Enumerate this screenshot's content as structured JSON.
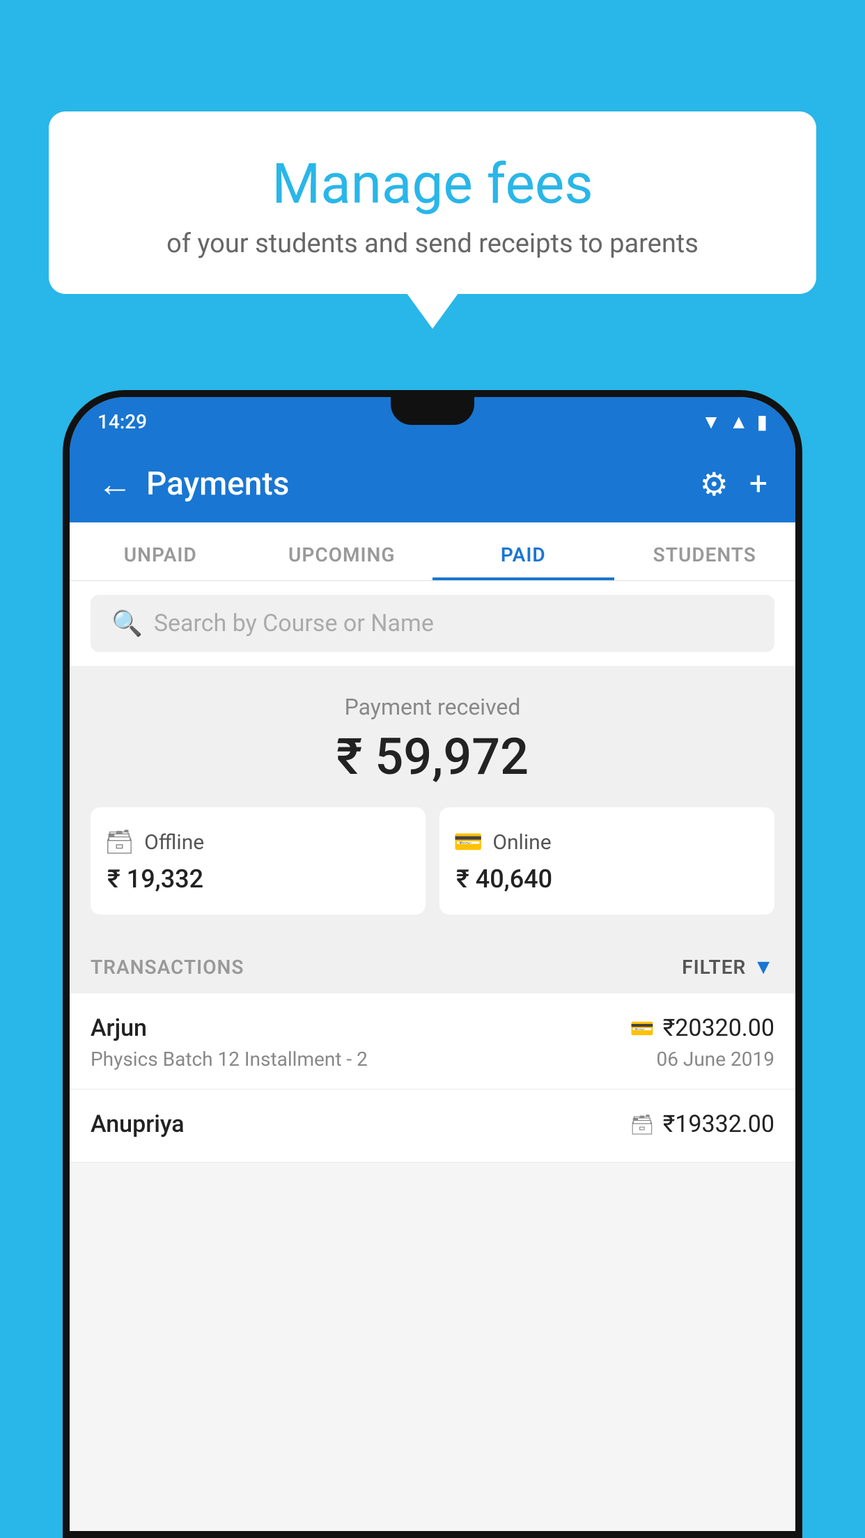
{
  "background_color": "#29b6e8",
  "bubble": {
    "title": "Manage fees",
    "subtitle": "of your students and send receipts to parents"
  },
  "status_bar": {
    "time": "14:29",
    "wifi": "▼",
    "signal": "▲",
    "battery": "▮"
  },
  "app_bar": {
    "title": "Payments",
    "back_label": "←",
    "gear_label": "⚙",
    "plus_label": "+"
  },
  "tabs": [
    {
      "id": "unpaid",
      "label": "UNPAID",
      "active": false
    },
    {
      "id": "upcoming",
      "label": "UPCOMING",
      "active": false
    },
    {
      "id": "paid",
      "label": "PAID",
      "active": true
    },
    {
      "id": "students",
      "label": "STUDENTS",
      "active": false
    }
  ],
  "search": {
    "placeholder": "Search by Course or Name"
  },
  "payment": {
    "received_label": "Payment received",
    "total_amount": "₹ 59,972",
    "offline_label": "Offline",
    "offline_amount": "₹ 19,332",
    "online_label": "Online",
    "online_amount": "₹ 40,640"
  },
  "transactions": {
    "header_label": "TRANSACTIONS",
    "filter_label": "FILTER",
    "items": [
      {
        "name": "Arjun",
        "amount": "₹20320.00",
        "course": "Physics Batch 12 Installment - 2",
        "date": "06 June 2019",
        "payment_type": "online"
      },
      {
        "name": "Anupriya",
        "amount": "₹19332.00",
        "course": "",
        "date": "",
        "payment_type": "offline"
      }
    ]
  }
}
